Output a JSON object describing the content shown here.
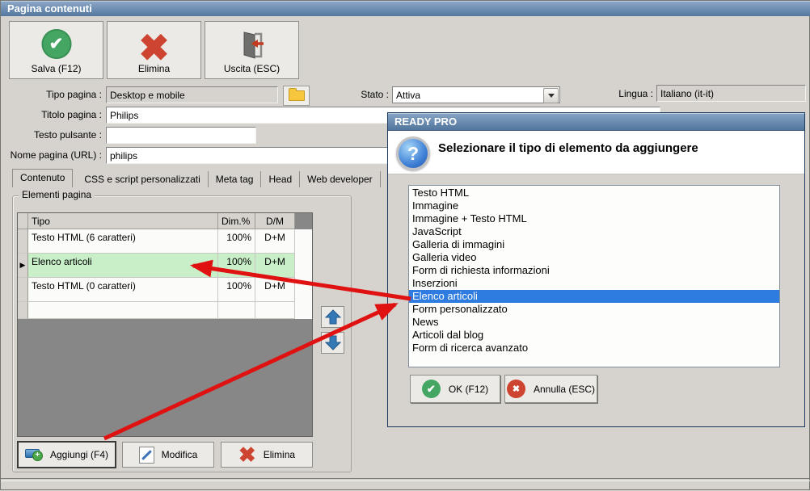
{
  "window": {
    "title": "Pagina contenuti"
  },
  "toolbar": {
    "save": "Salva (F12)",
    "delete": "Elimina",
    "exit": "Uscita (ESC)"
  },
  "form": {
    "tipo_pagina_label": "Tipo pagina :",
    "tipo_pagina_value": "Desktop e mobile",
    "stato_label": "Stato :",
    "stato_value": "Attiva",
    "lingua_label": "Lingua :",
    "lingua_value": "Italiano (it-it)",
    "titolo_label": "Titolo pagina :",
    "titolo_value": "Philips",
    "testo_pulsante_label": "Testo pulsante :",
    "testo_pulsante_value": "",
    "nome_pagina_label": "Nome pagina (URL) :",
    "nome_pagina_value": "philips"
  },
  "tabs": [
    {
      "label": "Contenuto",
      "active": true
    },
    {
      "label": "CSS e script personalizzati",
      "active": false
    },
    {
      "label": "Meta tag",
      "active": false
    },
    {
      "label": "Head",
      "active": false
    },
    {
      "label": "Web developer",
      "active": false
    }
  ],
  "elementi": {
    "group_label": "Elementi pagina",
    "columns": [
      "Tipo",
      "Dim.%",
      "D/M"
    ],
    "rows": [
      {
        "tipo": "Testo HTML (6 caratteri)",
        "dim": "100%",
        "dm": "D+M",
        "selected": false
      },
      {
        "tipo": "Elenco articoli",
        "dim": "100%",
        "dm": "D+M",
        "selected": true
      },
      {
        "tipo": "Testo HTML (0 caratteri)",
        "dim": "100%",
        "dm": "D+M",
        "selected": false
      }
    ],
    "row_marker": "▶",
    "add": "Aggiungi (F4)",
    "edit": "Modifica",
    "delete": "Elimina"
  },
  "dialog": {
    "title": "READY PRO",
    "message": "Selezionare il tipo di elemento da aggiungere",
    "icon_glyph": "?",
    "items": [
      "Testo HTML",
      "Immagine",
      "Immagine + Testo HTML",
      "JavaScript",
      "Galleria di immagini",
      "Galleria video",
      "Form di richiesta informazioni",
      "Inserzioni",
      "Elenco articoli",
      "Form personalizzato",
      "News",
      "Articoli dal blog",
      "Form di ricerca avanzato"
    ],
    "selected_index": 8,
    "ok": "OK (F12)",
    "cancel": "Annulla (ESC)"
  },
  "colors": {
    "selection_blue": "#2f7ce0",
    "row_highlight_green": "#c9efc9",
    "arrow_red": "#e01111",
    "titlebar_blue": "#54779f"
  }
}
